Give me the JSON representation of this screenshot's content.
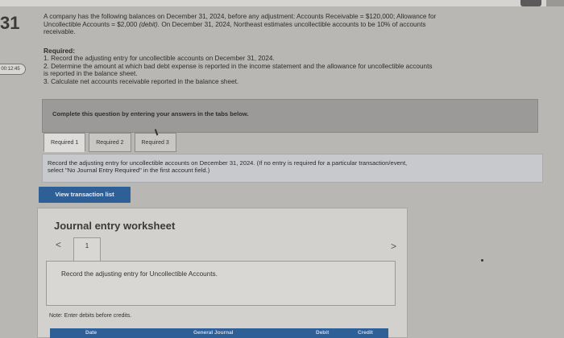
{
  "question_number": "31",
  "timer": "00:12:45",
  "problem": {
    "line1": "A company has the following balances on December 31, 2024, before any adjustment: Accounts Receivable = $120,000; Allowance for",
    "line2_a": "Uncollectible Accounts = $2,000 ",
    "line2_italic": "(debit).",
    "line2_b": " On December 31, 2024, Northeast estimates uncollectible accounts to be 10% of accounts",
    "line3": "receivable."
  },
  "required": {
    "heading": "Required:",
    "items": [
      "1. Record the adjusting entry for uncollectible accounts on December 31, 2024.",
      "2. Determine the amount at which bad debt expense is reported in the income statement and the allowance for uncollectible accounts",
      "is reported in the balance sheet.",
      "3. Calculate net accounts receivable reported in the balance sheet."
    ]
  },
  "banner_text": "Complete this question by entering your answers in the tabs below.",
  "tabs": [
    "Required 1",
    "Required 2",
    "Required 3"
  ],
  "instruction": {
    "line1": "Record the adjusting entry for uncollectible accounts on December 31, 2024. (If no entry is required for a particular transaction/event,",
    "line2": "select \"No Journal Entry Required\" in the first account field.)"
  },
  "view_transaction_list": "View transaction list",
  "worksheet": {
    "title": "Journal entry worksheet",
    "page": "1",
    "prev": "<",
    "next": ">",
    "description": "Record the adjusting entry for Uncollectible Accounts.",
    "note": "Note: Enter debits before credits.",
    "columns": [
      "Date",
      "General Journal",
      "Debit",
      "Credit"
    ]
  }
}
